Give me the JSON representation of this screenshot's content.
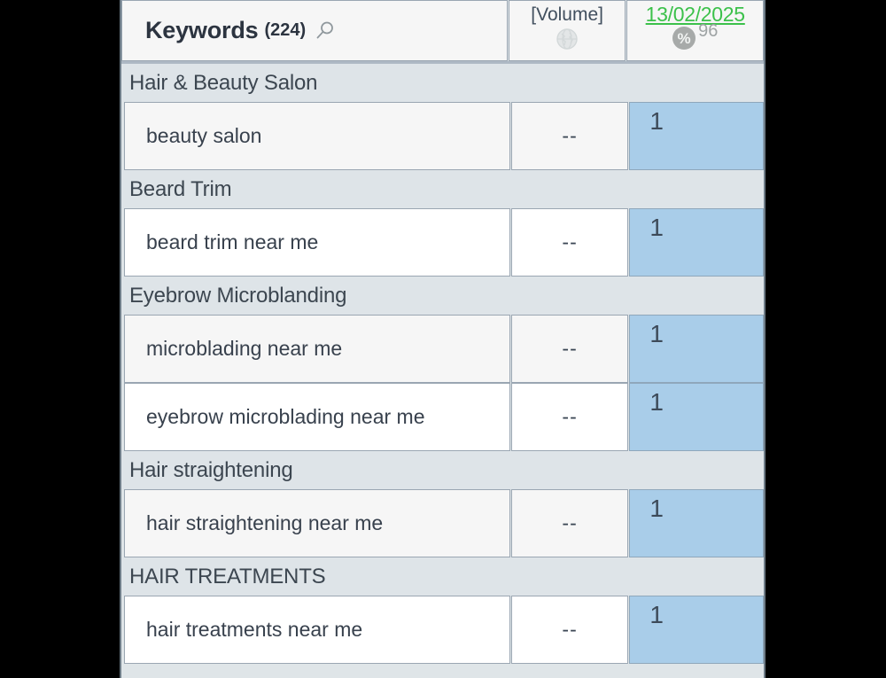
{
  "table": {
    "columns": {
      "keywords": {
        "title": "Keywords",
        "count": "(224)",
        "search_icon": "search-icon"
      },
      "volume": {
        "label": "[Volume]",
        "icon": "globe-icon"
      },
      "rank": {
        "date": "13/02/2025",
        "percent_icon": "percent-icon",
        "percent_glyph": "%",
        "percent_value": "96"
      }
    },
    "groups": [
      {
        "label": "Hair & Beauty Salon",
        "rows": [
          {
            "keyword": "beauty salon",
            "volume": "--",
            "rank": "1"
          }
        ]
      },
      {
        "label": "Beard Trim",
        "rows": [
          {
            "keyword": "beard trim near me",
            "volume": "--",
            "rank": "1"
          }
        ]
      },
      {
        "label": "Eyebrow Microblanding",
        "rows": [
          {
            "keyword": "microblading near me",
            "volume": "--",
            "rank": "1"
          },
          {
            "keyword": "eyebrow microblading near me",
            "volume": "--",
            "rank": "1"
          }
        ]
      },
      {
        "label": "Hair straightening",
        "rows": [
          {
            "keyword": "hair straightening near me",
            "volume": "--",
            "rank": "1"
          }
        ]
      },
      {
        "label": "HAIR TREATMENTS",
        "rows": [
          {
            "keyword": "hair treatments near me",
            "volume": "--",
            "rank": "1"
          }
        ]
      }
    ]
  },
  "colors": {
    "panel_background": "#dfe5e8",
    "group_header_background": "#dee4e8",
    "rank_cell_background": "#a9cde9",
    "date_link": "#3cc14b",
    "row_alt_background": "#f6f6f6",
    "row_background": "#ffffff",
    "border": "#9aa6b2",
    "text": "#38414d",
    "page_background": "#000000"
  }
}
